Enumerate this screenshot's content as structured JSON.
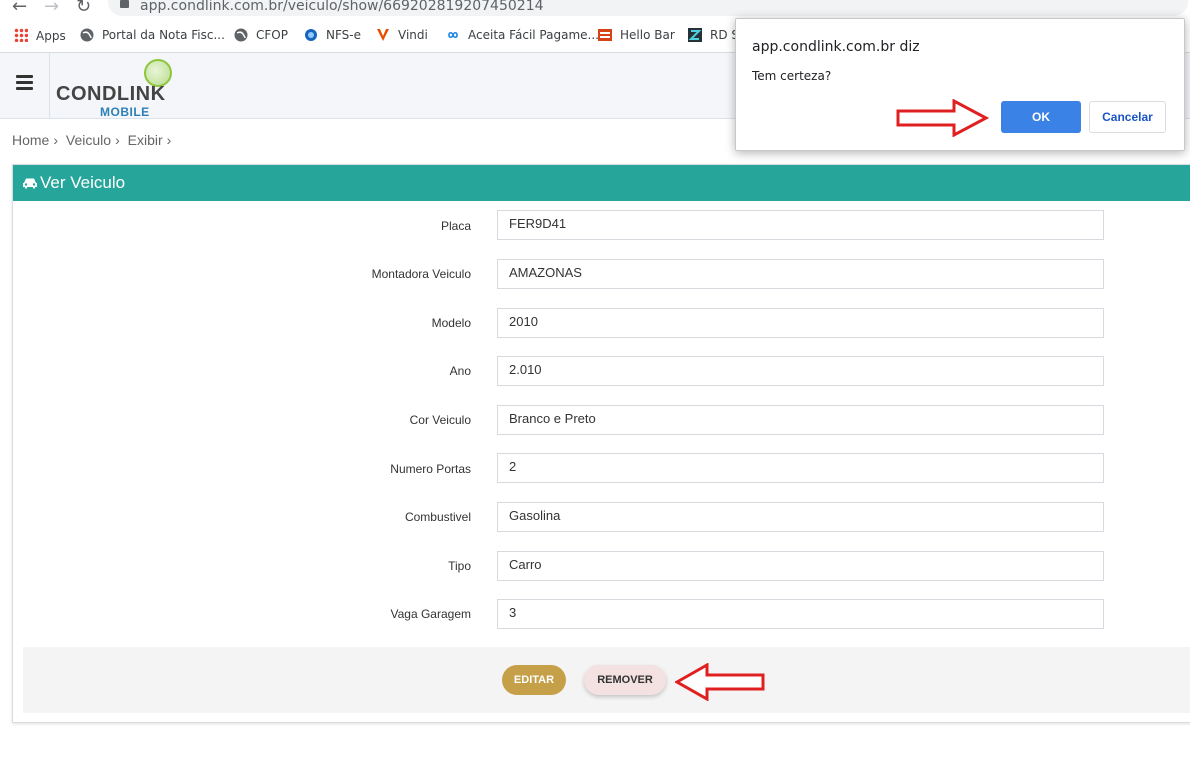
{
  "browser": {
    "url": "app.condlink.com.br/veiculo/show/669202819207450214",
    "bookmarks": [
      {
        "label": "Apps"
      },
      {
        "label": "Portal da Nota Fisc..."
      },
      {
        "label": "CFOP"
      },
      {
        "label": "NFS-e"
      },
      {
        "label": "Vindi"
      },
      {
        "label": "Aceita Fácil Pagame..."
      },
      {
        "label": "Hello Bar"
      },
      {
        "label": "RD S"
      }
    ]
  },
  "header": {
    "logo_main": "CONDLINK",
    "logo_sub": "MOBILE"
  },
  "breadcrumb": [
    "Home",
    "Veiculo",
    "Exibir"
  ],
  "panel": {
    "title": "Ver Veiculo",
    "fields": [
      {
        "label": "Placa",
        "value": "FER9D41"
      },
      {
        "label": "Montadora Veiculo",
        "value": "AMAZONAS"
      },
      {
        "label": "Modelo",
        "value": "2010"
      },
      {
        "label": "Ano",
        "value": "2.010"
      },
      {
        "label": "Cor Veiculo",
        "value": "Branco e Preto"
      },
      {
        "label": "Numero Portas",
        "value": "2"
      },
      {
        "label": "Combustivel",
        "value": "Gasolina"
      },
      {
        "label": "Tipo",
        "value": "Carro"
      },
      {
        "label": "Vaga Garagem",
        "value": "3"
      }
    ],
    "edit_label": "EDITAR",
    "remove_label": "REMOVER"
  },
  "dialog": {
    "title": "app.condlink.com.br diz",
    "message": "Tem certeza?",
    "ok_label": "OK",
    "cancel_label": "Cancelar"
  },
  "colors": {
    "panel_header": "#26a69a",
    "edit_button": "#c5a049",
    "ok_button": "#3b82e6",
    "annotation_arrow": "#e02020"
  }
}
